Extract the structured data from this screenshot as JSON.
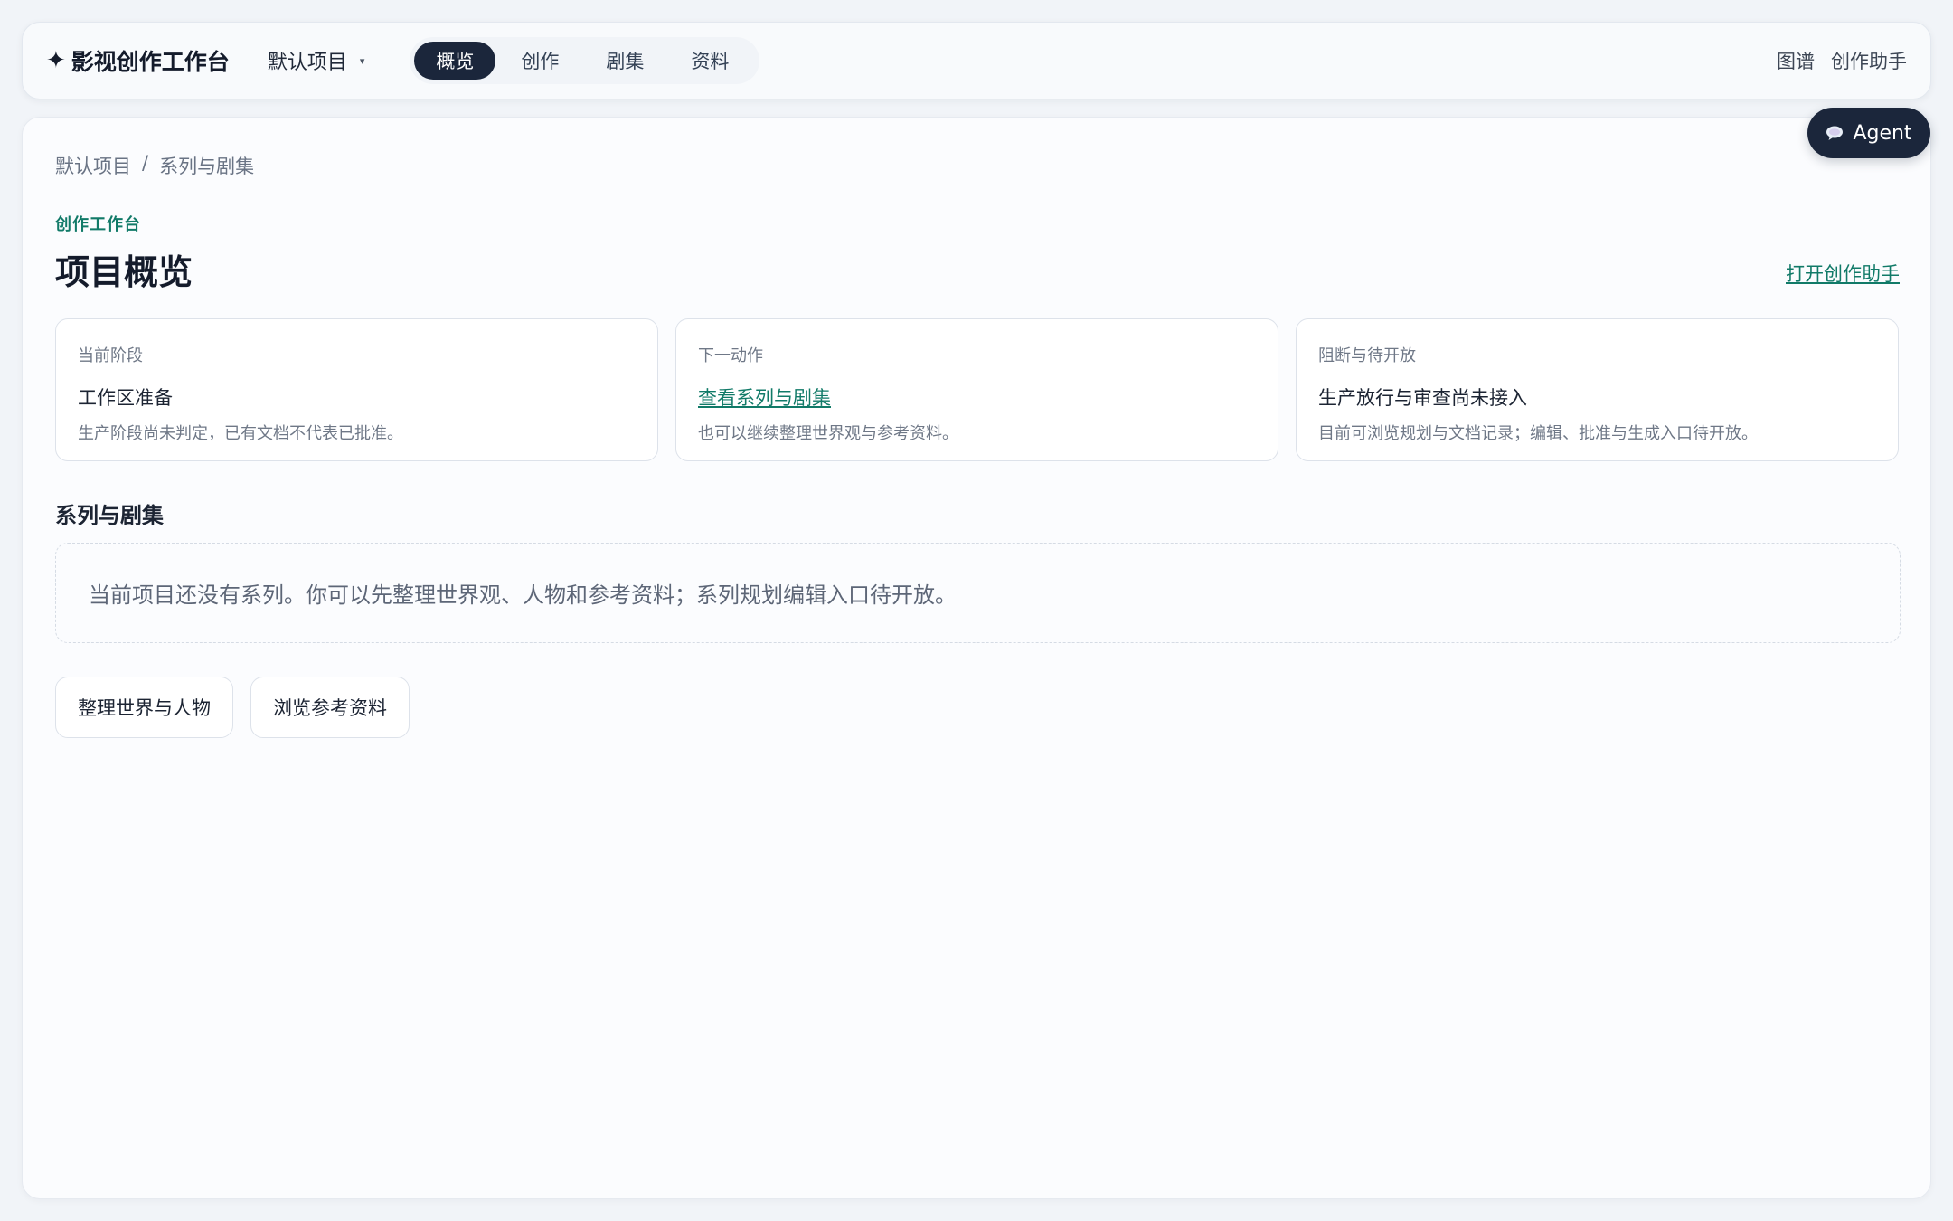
{
  "header": {
    "brand_icon": "sparkle-icon",
    "brand_glyph": "✦",
    "brand_name": "影视创作工作台",
    "project_select": {
      "value": "默认项目",
      "caret": "▾"
    },
    "tabs": [
      {
        "label": "概览",
        "active": true
      },
      {
        "label": "创作",
        "active": false
      },
      {
        "label": "剧集",
        "active": false
      },
      {
        "label": "资料",
        "active": false
      }
    ],
    "right_links": {
      "graph": "图谱",
      "assistant": "创作助手"
    }
  },
  "agent_button": {
    "icon": "chat-bubble-icon",
    "label": "Agent"
  },
  "breadcrumb": {
    "project": "默认项目",
    "separator": "/",
    "current": "系列与剧集"
  },
  "page": {
    "eyebrow": "创作工作台",
    "title": "项目概览",
    "assistant_link": "打开创作助手"
  },
  "cards": [
    {
      "label": "当前阶段",
      "value": "工作区准备",
      "note": "生产阶段尚未判定，已有文档不代表已批准。"
    },
    {
      "label": "下一动作",
      "value": "查看系列与剧集",
      "note": "也可以继续整理世界观与参考资料。"
    },
    {
      "label": "阻断与待开放",
      "value": "生产放行与审查尚未接入",
      "note": "目前可浏览规划与文档记录；编辑、批准与生成入口待开放。"
    }
  ],
  "series_section": {
    "heading": "系列与剧集",
    "empty_message": "当前项目还没有系列。你可以先整理世界观、人物和参考资料；系列规划编辑入口待开放。"
  },
  "actions": {
    "organize_world": "整理世界与人物",
    "browse_references": "浏览参考资料"
  },
  "colors": {
    "accent": "#117a68",
    "dark": "#1b263b",
    "background": "#f1f4f8"
  }
}
